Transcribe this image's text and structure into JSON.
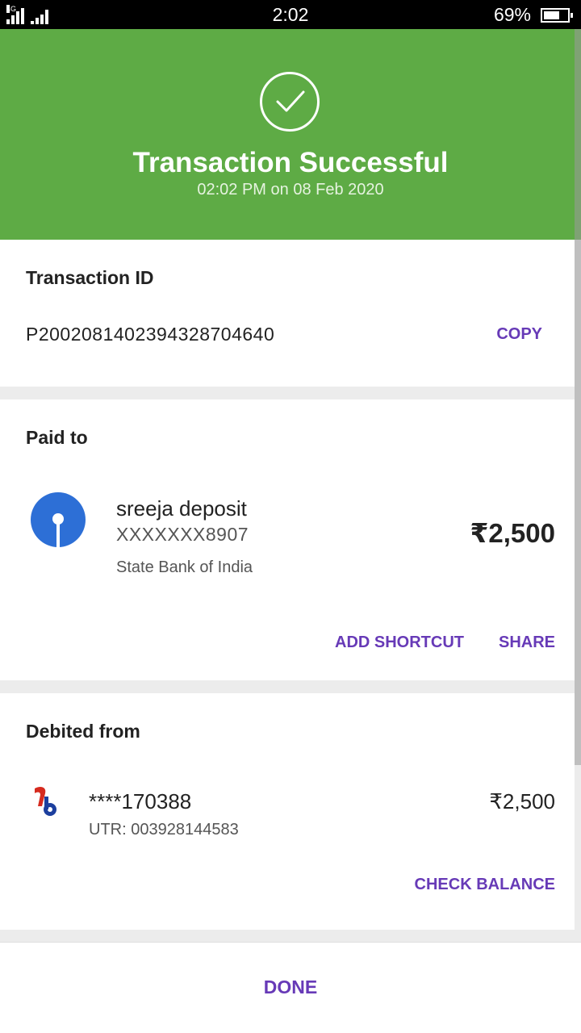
{
  "status_bar": {
    "network": "4G",
    "time": "2:02",
    "battery_percent": "69%",
    "battery_level": 0.69,
    "icons": [
      "signal-icon",
      "signal-icon",
      "battery-icon"
    ]
  },
  "header": {
    "icon": "check-circle-icon",
    "title": "Transaction Successful",
    "subtitle": "02:02 PM on 08 Feb 2020",
    "bg_color": "#5eab45"
  },
  "transaction": {
    "label": "Transaction ID",
    "id": "P2002081402394328704640",
    "copy_label": "COPY"
  },
  "paid_to": {
    "label": "Paid to",
    "logo_icon": "sbi-logo-icon",
    "name": "sreeja deposit",
    "account": "XXXXXXX8907",
    "bank": "State Bank of India",
    "amount": "₹2,500",
    "add_shortcut_label": "ADD SHORTCUT",
    "share_label": "SHARE"
  },
  "debited_from": {
    "label": "Debited from",
    "logo_icon": "bank-logo-icon",
    "account": "****170388",
    "utr": "UTR: 003928144583",
    "amount": "₹2,500",
    "check_balance_label": "CHECK BALANCE"
  },
  "footer": {
    "done_label": "DONE"
  },
  "colors": {
    "accent": "#673ab7",
    "success": "#5eab45"
  }
}
